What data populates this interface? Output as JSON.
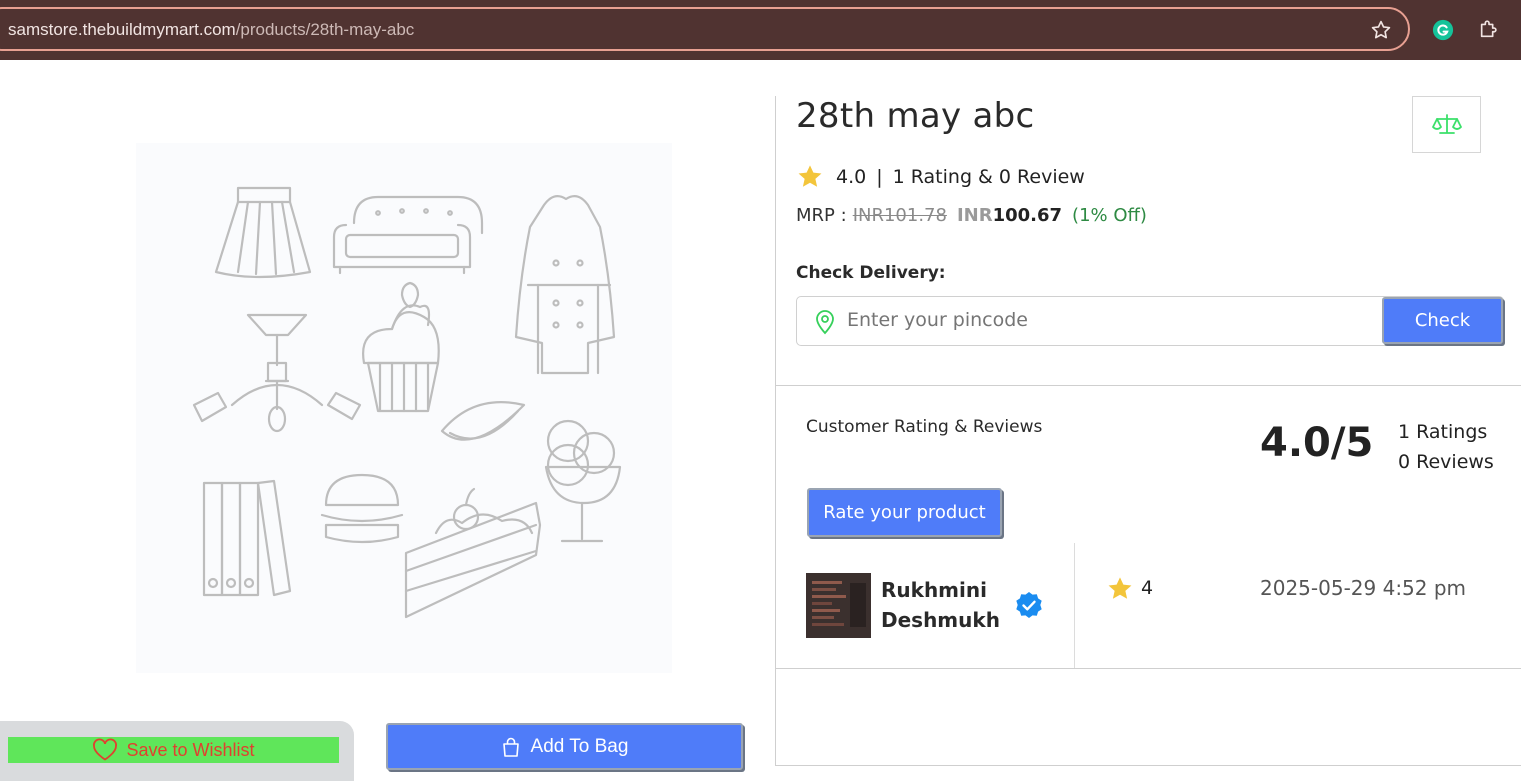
{
  "browser": {
    "url_host": "samstore.thebuildmymart.com",
    "url_path": "/products/28th-may-abc"
  },
  "left": {
    "wishlist_label": "Save to Wishlist",
    "bag_label": "Add To Bag"
  },
  "product": {
    "title": "28th may abc",
    "rating": "4.0",
    "rating_summary": "1 Rating & 0 Review",
    "mrp_label": "MRP :",
    "mrp_old": "INR101.78",
    "currency": "INR",
    "price": "100.67",
    "discount": "(1% Off)"
  },
  "delivery": {
    "label": "Check Delivery:",
    "placeholder": "Enter your pincode",
    "check_label": "Check"
  },
  "reviews": {
    "title": "Customer Rating & Reviews",
    "score": "4.0/5",
    "ratings_count": "1 Ratings",
    "reviews_count": "0 Reviews",
    "rate_label": "Rate your product",
    "items": [
      {
        "name": "Rukhmini Deshmukh",
        "rating": "4",
        "date": "2025-05-29 4:52 pm"
      }
    ]
  },
  "colors": {
    "accent": "#4f7cf9",
    "star": "#f3c53b",
    "verified": "#1a8cf0",
    "wishlist_bg": "#5fe65a",
    "discount": "#2e8a43"
  }
}
